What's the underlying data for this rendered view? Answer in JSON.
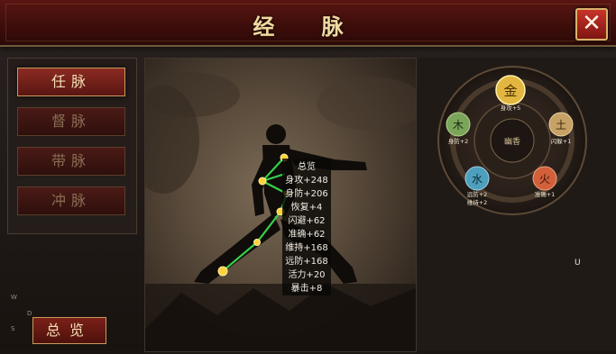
{
  "title": "经 脉",
  "close_label": "✕",
  "tabs": [
    {
      "label": "任脉",
      "active": true
    },
    {
      "label": "督脉",
      "active": false
    },
    {
      "label": "带脉",
      "active": false
    },
    {
      "label": "冲脉",
      "active": false
    }
  ],
  "overview_button": "总览",
  "tooltip": {
    "header": "总览",
    "lines": [
      "身攻+248",
      "身防+206",
      "恢复+4",
      "闪避+62",
      "准确+62",
      "维持+168",
      "远防+168",
      "活力+20",
      "暴击+8"
    ]
  },
  "elements": {
    "center": "幽香",
    "metal": {
      "glyph": "金",
      "stats": [
        "身攻+5"
      ],
      "color": "#e2b640"
    },
    "wood": {
      "glyph": "木",
      "stats": [
        "身防+2"
      ],
      "color": "#7aa55a"
    },
    "earth": {
      "glyph": "土",
      "stats": [
        "闪躲+1"
      ],
      "color": "#c7a267"
    },
    "water": {
      "glyph": "水",
      "stats": [
        "远防+2",
        "维持+2"
      ],
      "color": "#4d9fbd"
    },
    "fire": {
      "glyph": "火",
      "stats": [
        "准确+1"
      ],
      "color": "#d1603b"
    }
  },
  "compass": {
    "w": "W",
    "d": "D",
    "s": "S"
  },
  "misc_letter": "U",
  "colors": {
    "accent_gold": "#f2d9a0",
    "meridian_line": "#35d14a",
    "acupoint": "#ffd23a"
  }
}
